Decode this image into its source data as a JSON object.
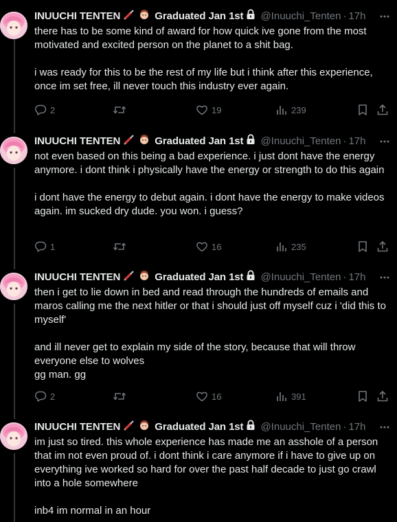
{
  "colors": {
    "background": "#000000",
    "text_primary": "#e7e9ea",
    "text_secondary": "#71767b",
    "thread_line": "#333639",
    "lock_icon": "#e7e9ea"
  },
  "icons": {
    "badge_1": "syringe-icon",
    "badge_2": "person-face-icon",
    "verified": "lock-icon",
    "more": "more-horizontal-icon",
    "reply": "reply-bubble-icon",
    "retweet": "retweet-icon",
    "like": "heart-icon",
    "views": "views-bar-chart-icon",
    "bookmark": "bookmark-icon",
    "share": "share-icon"
  },
  "tweets": [
    {
      "display_name": "INUUCHI TENTEN",
      "badge_text": "Graduated Jan 1st",
      "handle": "@Inuuchi_Tenten",
      "dot": "·",
      "time": "17h",
      "text": "there has to be some kind of award for how quick ive gone from the most motivated and excited person on the planet to a shit bag.\n\ni was ready for this to be the rest of my life but i think after this experience, once im set free, ill never touch this industry ever again.",
      "replies": "2",
      "retweets": "",
      "likes": "19",
      "views": "239"
    },
    {
      "display_name": "INUUCHI TENTEN",
      "badge_text": "Graduated Jan 1st",
      "handle": "@Inuuchi_Tenten",
      "dot": "·",
      "time": "17h",
      "text": "not even based on this being a bad experience. i just dont have the energy anymore. i dont think i physically have the energy or strength to do this again\n\ni dont have the energy to debut again. i dont have the energy to make videos again. im sucked dry dude. you won. i guess?",
      "replies": "1",
      "retweets": "",
      "likes": "16",
      "views": "235"
    },
    {
      "display_name": "INUUCHI TENTEN",
      "badge_text": "Graduated Jan 1st",
      "handle": "@Inuuchi_Tenten",
      "dot": "·",
      "time": "17h",
      "text": "then i get to lie down in bed and read through the hundreds of emails and maros calling me the next hitler or that i should just off myself cuz i 'did this to myself'\n\nand ill never get to explain my side of the story, because that will throw everyone else to wolves\ngg man. gg",
      "replies": "2",
      "retweets": "",
      "likes": "16",
      "views": "391"
    },
    {
      "display_name": "INUUCHI TENTEN",
      "badge_text": "Graduated Jan 1st",
      "handle": "@Inuuchi_Tenten",
      "dot": "·",
      "time": "17h",
      "text": "im just so tired. this whole experience has made me an asshole of a person that im not even proud of. i dont think i care anymore if i have to give up on everything ive worked so hard for over the past half decade to just go crawl into a hole somewhere\n\ninb4 im normal in an hour",
      "replies": "",
      "retweets": "",
      "likes": "",
      "views": ""
    }
  ]
}
